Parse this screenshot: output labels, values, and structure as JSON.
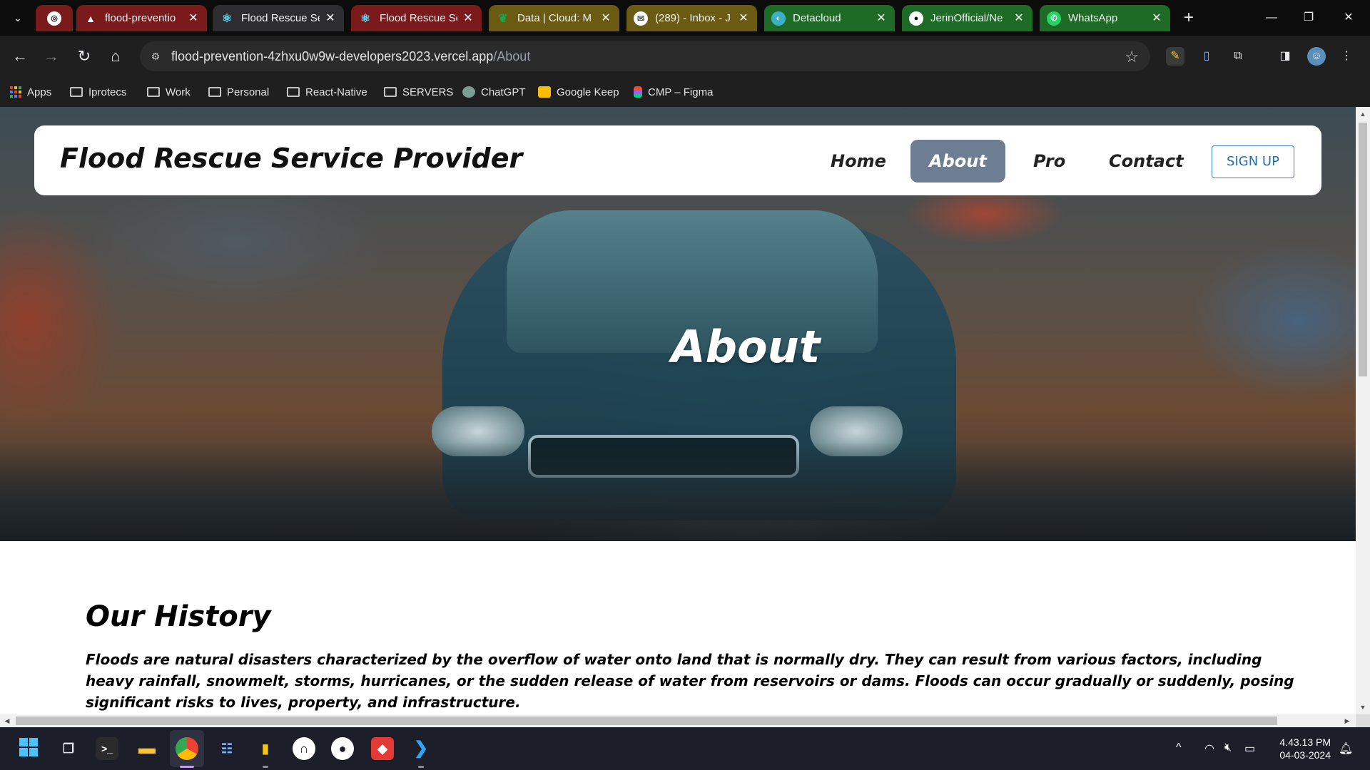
{
  "browser": {
    "tabs": [
      {
        "title": "",
        "favicon": "chatgpt-icon",
        "style": "red"
      },
      {
        "title": "flood-preventio",
        "favicon": "vercel-icon",
        "style": "red"
      },
      {
        "title": "Flood Rescue Se",
        "favicon": "react-icon",
        "style": "active"
      },
      {
        "title": "Flood Rescue Se",
        "favicon": "react-icon",
        "style": "red"
      },
      {
        "title": "Data | Cloud: M",
        "favicon": "mongodb-icon",
        "style": "gold"
      },
      {
        "title": "(289) - Inbox - J",
        "favicon": "mail-icon",
        "style": "gold"
      },
      {
        "title": "Detacloud",
        "favicon": "detacloud-icon",
        "style": "green"
      },
      {
        "title": "JerinOfficial/Ne",
        "favicon": "github-icon",
        "style": "green"
      },
      {
        "title": "WhatsApp",
        "favicon": "whatsapp-icon",
        "style": "green"
      }
    ],
    "url_host": "flood-prevention-4zhxu0w9w-developers2023.vercel.app",
    "url_path": "/About",
    "bookmarks": [
      {
        "label": "Apps",
        "icon": "apps-grid-icon"
      },
      {
        "label": "Iprotecs",
        "icon": "folder-icon"
      },
      {
        "label": "Work",
        "icon": "folder-icon"
      },
      {
        "label": "Personal",
        "icon": "folder-icon"
      },
      {
        "label": "React-Native",
        "icon": "folder-icon"
      },
      {
        "label": "SERVERS",
        "icon": "folder-icon"
      },
      {
        "label": "ChatGPT",
        "icon": "chatgpt-icon"
      },
      {
        "label": "Google Keep",
        "icon": "keep-icon"
      },
      {
        "label": "CMP – Figma",
        "icon": "figma-icon"
      }
    ]
  },
  "site": {
    "brand": "Flood Rescue Service Provider",
    "nav": {
      "home": "Home",
      "about": "About",
      "pro": "Pro",
      "contact": "Contact",
      "signup": "SIGN UP"
    },
    "hero_title": "About",
    "history": {
      "title": "Our History",
      "text": "Floods are natural disasters characterized by the overflow of water onto land that is normally dry. They can result from various factors, including heavy rainfall, snowmelt, storms, hurricanes, or the sudden release of water from reservoirs or dams. Floods can occur gradually or suddenly, posing significant risks to lives, property, and infrastructure."
    }
  },
  "taskbar": {
    "time": "4.43.13 PM",
    "date": "04-03-2024"
  },
  "colors": {
    "nav_active": "#6d7e92",
    "signup_border": "#3b82c4"
  }
}
